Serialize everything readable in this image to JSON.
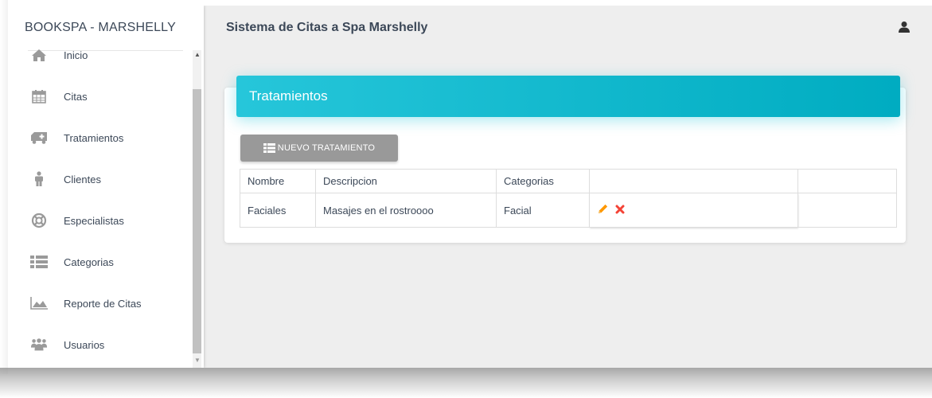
{
  "sidebar": {
    "brand": "BOOKSPA - MARSHELLY",
    "items": [
      {
        "label": "Inicio",
        "icon": "home-icon"
      },
      {
        "label": "Citas",
        "icon": "calendar-icon"
      },
      {
        "label": "Tratamientos",
        "icon": "ambulance-icon"
      },
      {
        "label": "Clientes",
        "icon": "person-icon"
      },
      {
        "label": "Especialistas",
        "icon": "lifebuoy-icon"
      },
      {
        "label": "Categorias",
        "icon": "list-icon"
      },
      {
        "label": "Reporte de Citas",
        "icon": "area-chart-icon"
      },
      {
        "label": "Usuarios",
        "icon": "users-icon"
      }
    ]
  },
  "header": {
    "title": "Sistema de Citas a Spa Marshelly",
    "user_icon": "user-icon"
  },
  "card": {
    "title": "Tratamientos",
    "new_button": "NUEVO TRATAMIENTO",
    "columns": [
      "Nombre",
      "Descripcion",
      "Categorias",
      "",
      ""
    ],
    "rows": [
      {
        "nombre": "Faciales",
        "descripcion": "Masajes en el rostroooo",
        "categoria": "Facial"
      }
    ]
  },
  "colors": {
    "header_gradient_start": "#26c6da",
    "header_gradient_end": "#00acc1",
    "button_gray": "#999999",
    "edit_icon": "#ff9800",
    "delete_icon": "#f44336"
  }
}
